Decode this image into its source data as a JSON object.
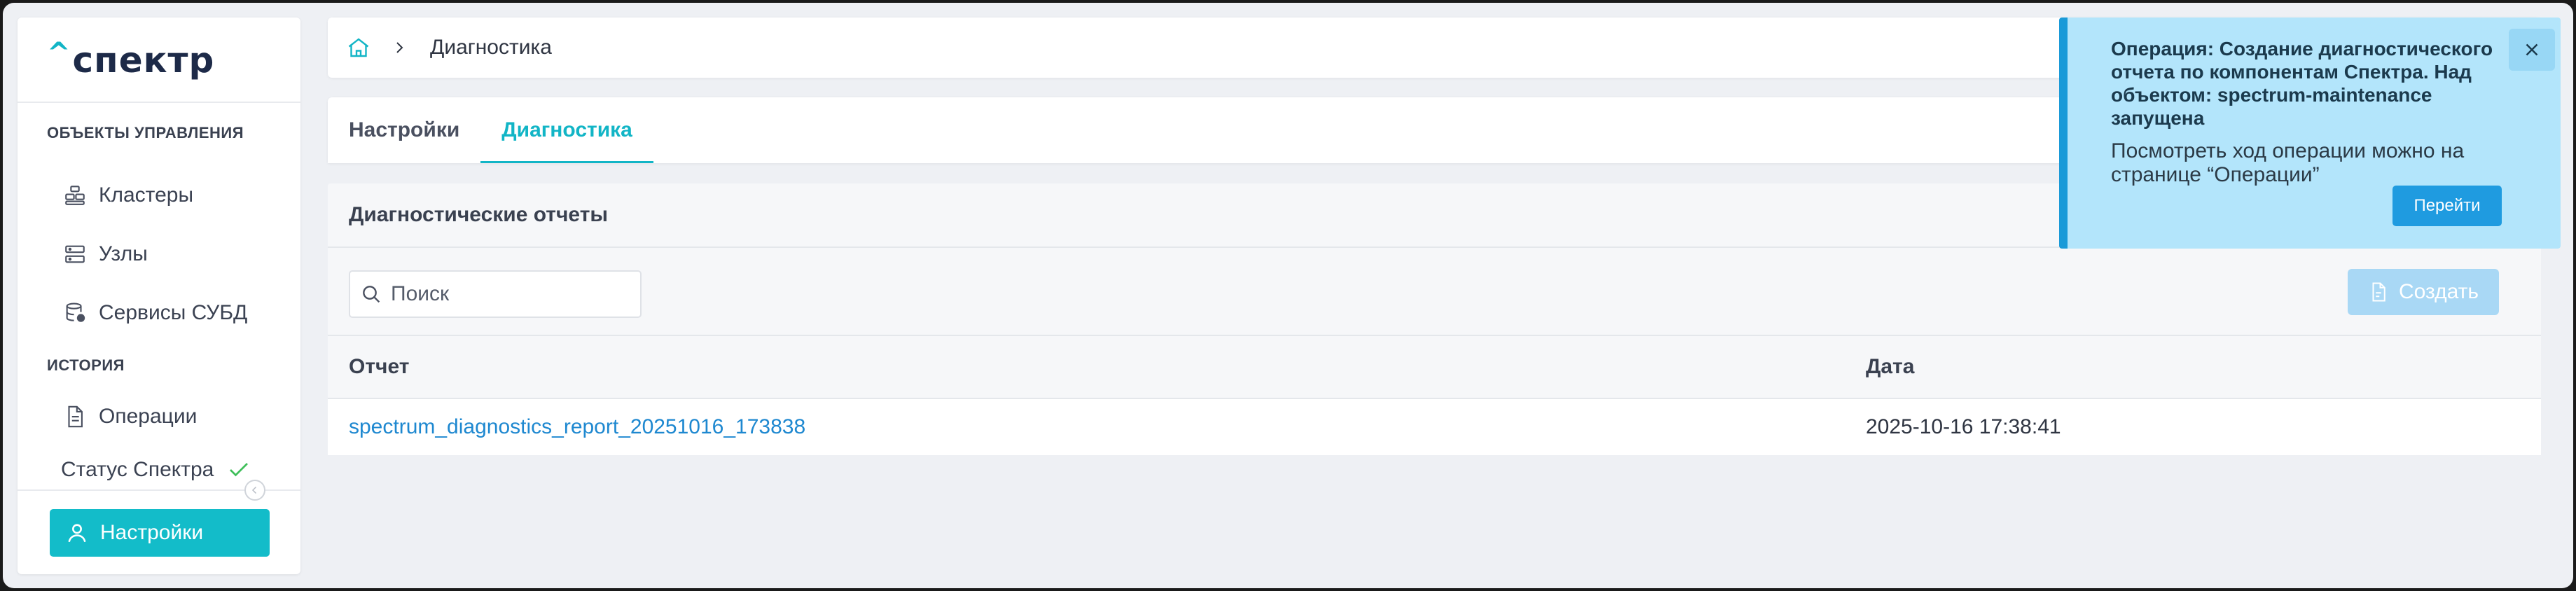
{
  "app": {
    "logo_caret": "^",
    "logo_text": "спектр"
  },
  "sidebar": {
    "section_objects": "ОБЪЕКТЫ УПРАВЛЕНИЯ",
    "section_history": "ИСТОРИЯ",
    "items": [
      {
        "label": "Кластеры",
        "icon": "cluster-icon"
      },
      {
        "label": "Узлы",
        "icon": "server-icon"
      },
      {
        "label": "Сервисы СУБД",
        "icon": "database-service-icon"
      },
      {
        "label": "Операции",
        "icon": "document-icon"
      }
    ],
    "status_label": "Статус Спектра",
    "settings_label": "Настройки"
  },
  "breadcrumb": {
    "current": "Диагностика"
  },
  "tabs": [
    {
      "label": "Настройки",
      "active": false
    },
    {
      "label": "Диагностика",
      "active": true
    }
  ],
  "reports": {
    "title": "Диагностические отчеты",
    "search_placeholder": "Поиск",
    "create_label": "Создать",
    "columns": [
      "Отчет",
      "Дата"
    ],
    "rows": [
      {
        "name": "spectrum_diagnostics_report_20251016_173838",
        "date": "2025-10-16 17:38:41"
      }
    ]
  },
  "notification": {
    "title": "Операция: Создание диагностического отчета по компонентам Спектра. Над объектом: spectrum-maintenance запущена",
    "text": "Посмотреть ход операции можно на странице “Операции”",
    "button_label": "Перейти"
  },
  "colors": {
    "accent": "#12b5c6",
    "link": "#1e88d0",
    "notification_bg": "#b3e5fb",
    "notification_border": "#1a9ad8",
    "status_ok": "#3fbf5a",
    "create_disabled": "#a9d8f5"
  }
}
